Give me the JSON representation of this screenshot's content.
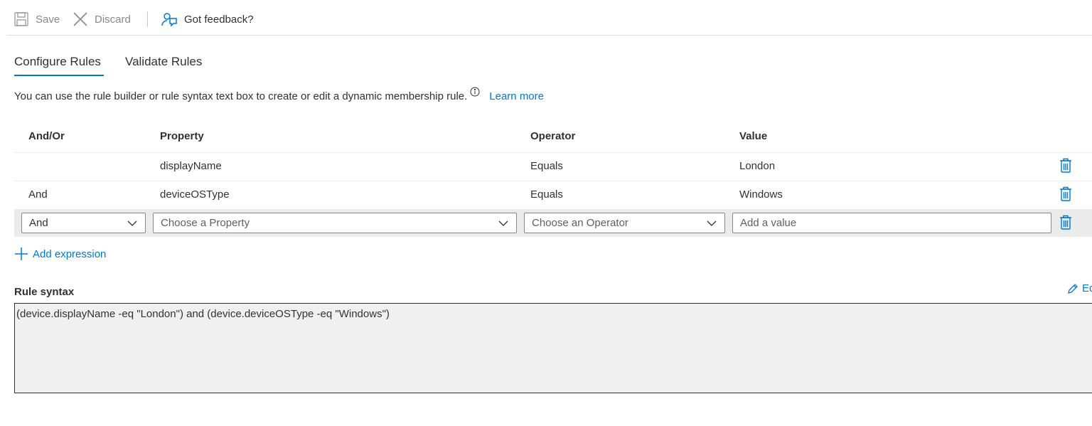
{
  "toolbar": {
    "save_label": "Save",
    "discard_label": "Discard",
    "feedback_label": "Got feedback?"
  },
  "tabs": [
    {
      "label": "Configure Rules",
      "active": true
    },
    {
      "label": "Validate Rules",
      "active": false
    }
  ],
  "description": {
    "text": "You can use the rule builder or rule syntax text box to create or edit a dynamic membership rule.",
    "learn_more": "Learn more"
  },
  "table": {
    "headers": {
      "and_or": "And/Or",
      "property": "Property",
      "operator": "Operator",
      "value": "Value"
    },
    "rows": [
      {
        "and_or": "",
        "property": "displayName",
        "operator": "Equals",
        "value": "London"
      },
      {
        "and_or": "And",
        "property": "deviceOSType",
        "operator": "Equals",
        "value": "Windows"
      }
    ],
    "edit_row": {
      "and_or_value": "And",
      "property_placeholder": "Choose a Property",
      "operator_placeholder": "Choose an Operator",
      "value_placeholder": "Add a value"
    }
  },
  "add_expression_label": "Add expression",
  "rule_syntax": {
    "label": "Rule syntax",
    "edit_label": "Edit",
    "text": "(device.displayName -eq \"London\") and (device.deviceOSType -eq \"Windows\")"
  },
  "colors": {
    "accent": "#0078d4",
    "text": "#323130",
    "muted": "#8a8886"
  }
}
